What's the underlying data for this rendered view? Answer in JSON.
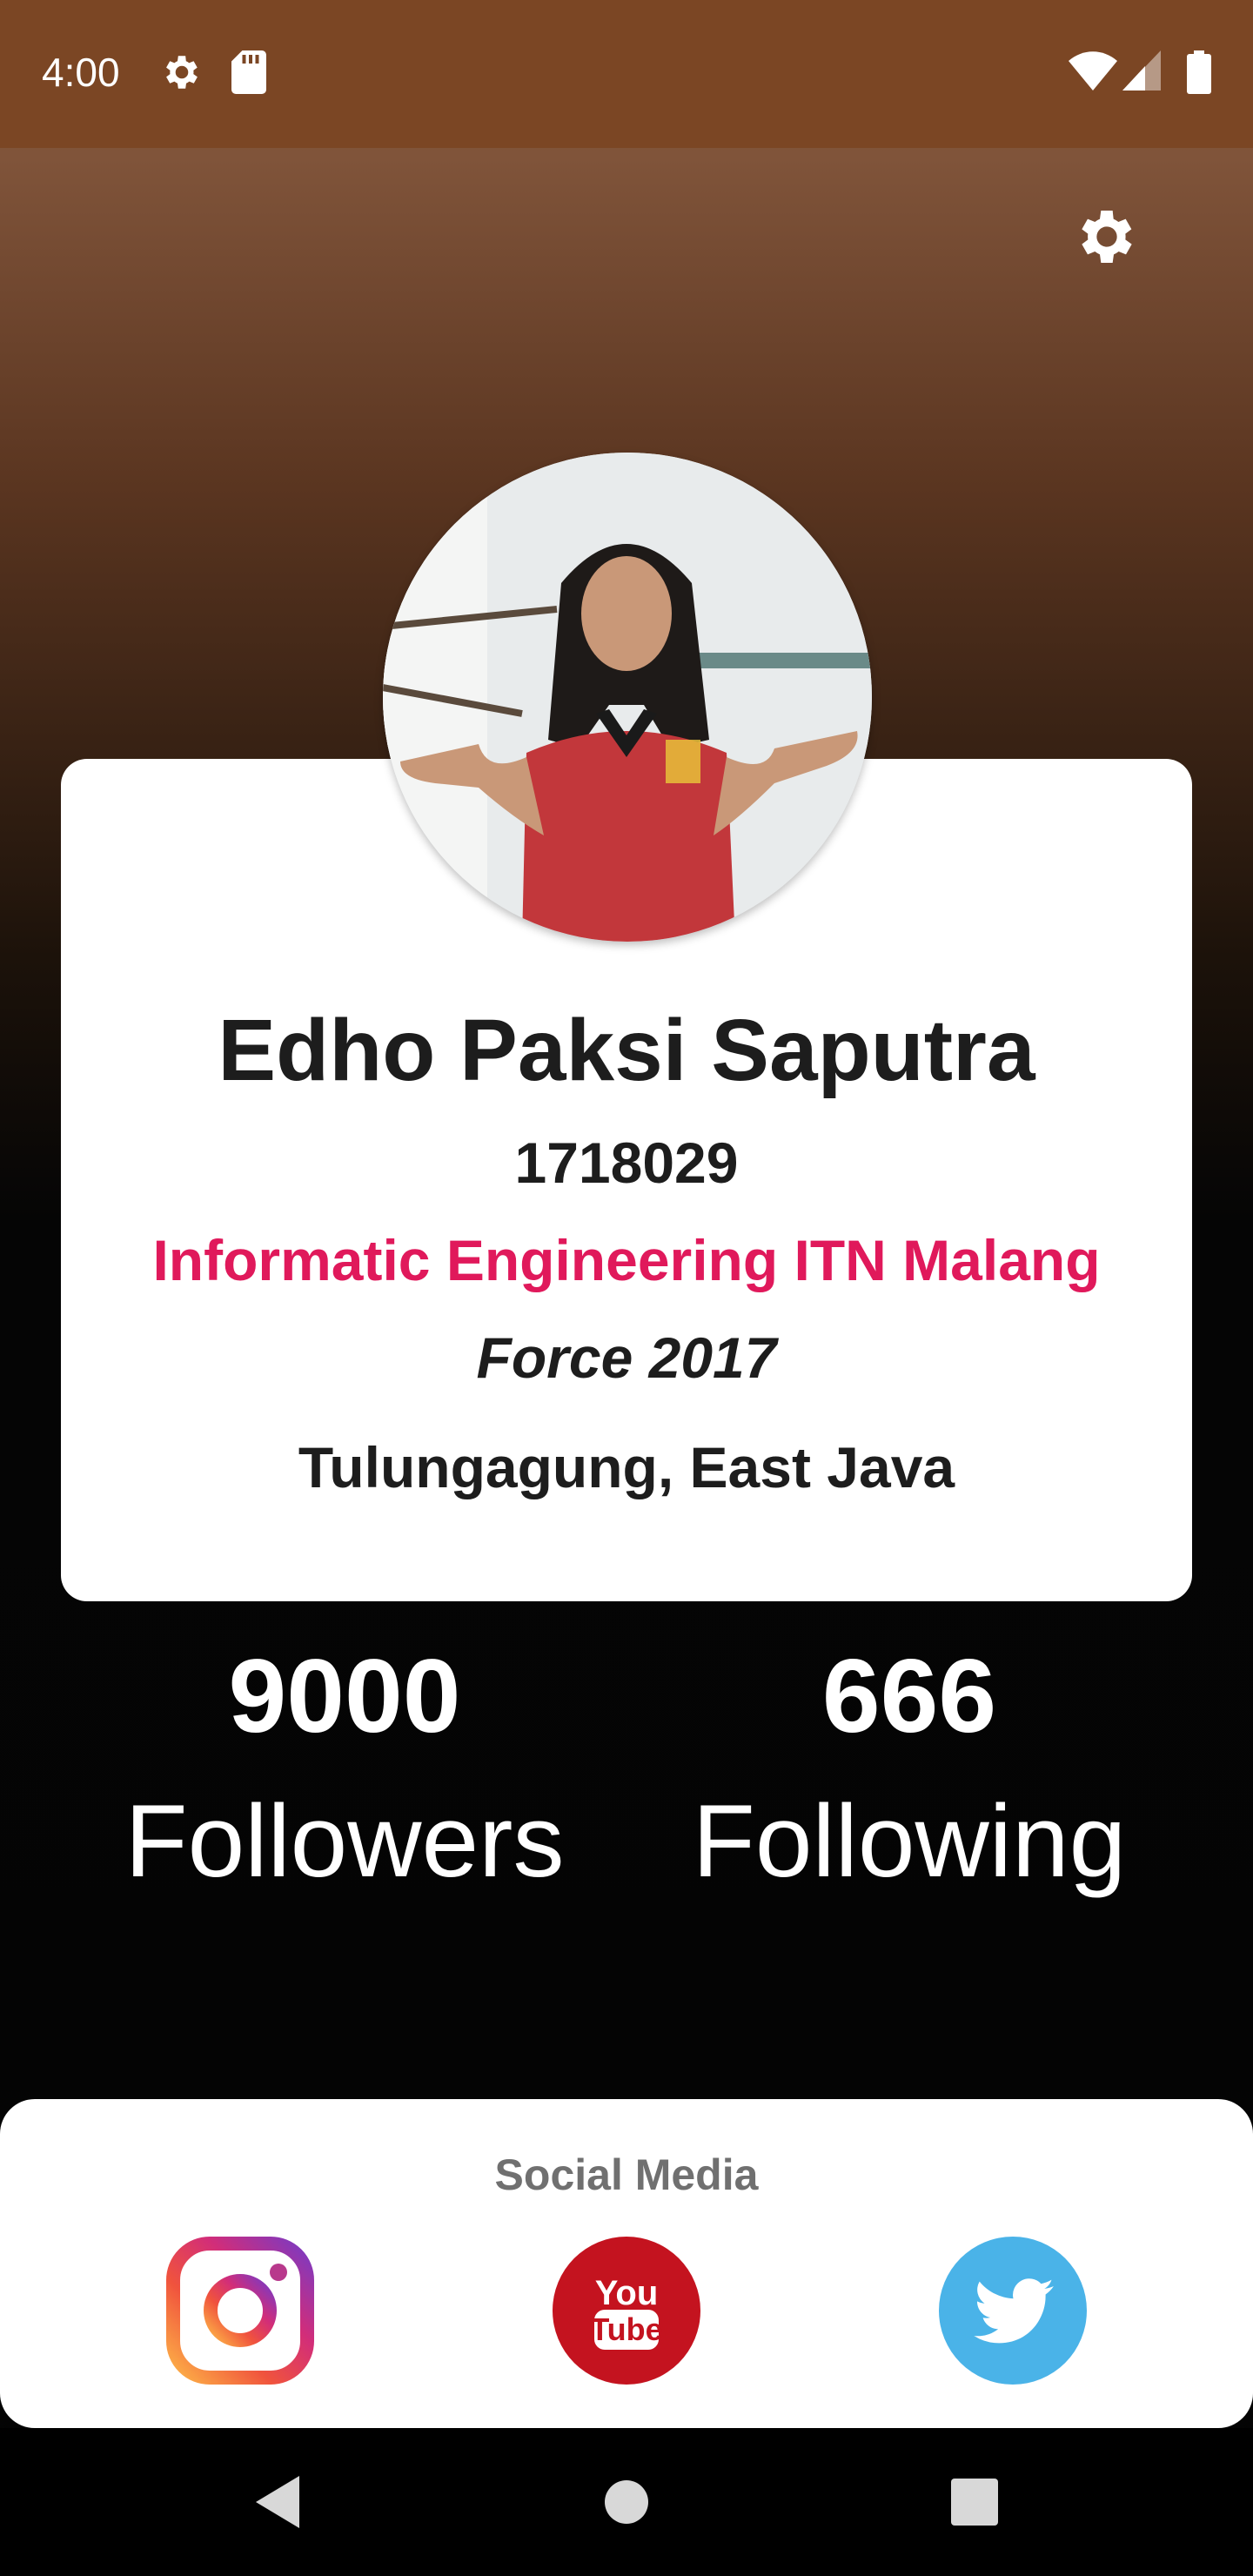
{
  "status_bar": {
    "time": "4:00"
  },
  "profile": {
    "name": "Edho Paksi Saputra",
    "student_id": "1718029",
    "major": "Informatic Engineering ITN Malang",
    "batch": "Force 2017",
    "hometown": "Tulungagung, East Java"
  },
  "stats": {
    "followers_count": "9000",
    "followers_label": "Followers",
    "following_count": "666",
    "following_label": "Following"
  },
  "social": {
    "title": "Social Media",
    "items": [
      "instagram-icon",
      "youtube-icon",
      "twitter-icon"
    ],
    "youtube_you": "You",
    "youtube_tube": "Tube"
  },
  "colors": {
    "status_bar": "#7b4624",
    "accent": "#e0195b",
    "youtube": "#c4131f",
    "twitter": "#4ab3e8"
  }
}
